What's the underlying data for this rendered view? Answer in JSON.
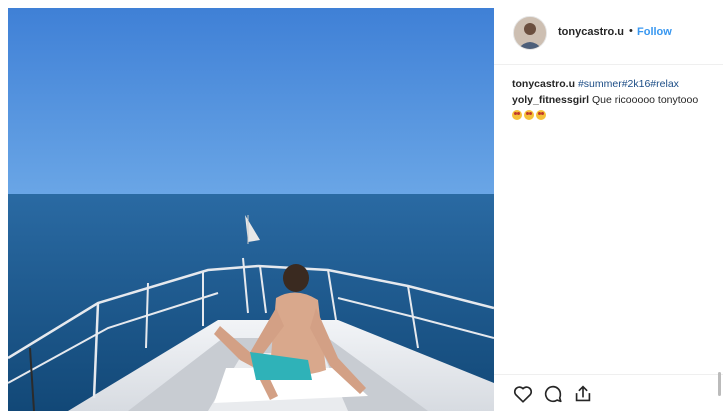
{
  "post": {
    "username": "tonycastro.u",
    "separator": "•",
    "follow_label": "Follow"
  },
  "caption": {
    "username": "tonycastro.u",
    "hashtags": "#summer#2k16#relax"
  },
  "comment": {
    "username": "yoly_fitnessgirl",
    "text": "Que ricooooo tonytooo",
    "emoji_count": 3
  },
  "icons": {
    "like": "heart-icon",
    "comment": "comment-icon",
    "share": "share-icon"
  },
  "colors": {
    "link_blue": "#3897f0",
    "hashtag_blue": "#1c4d86",
    "sky": "#4a88d8",
    "sea": "#1d5c95"
  }
}
